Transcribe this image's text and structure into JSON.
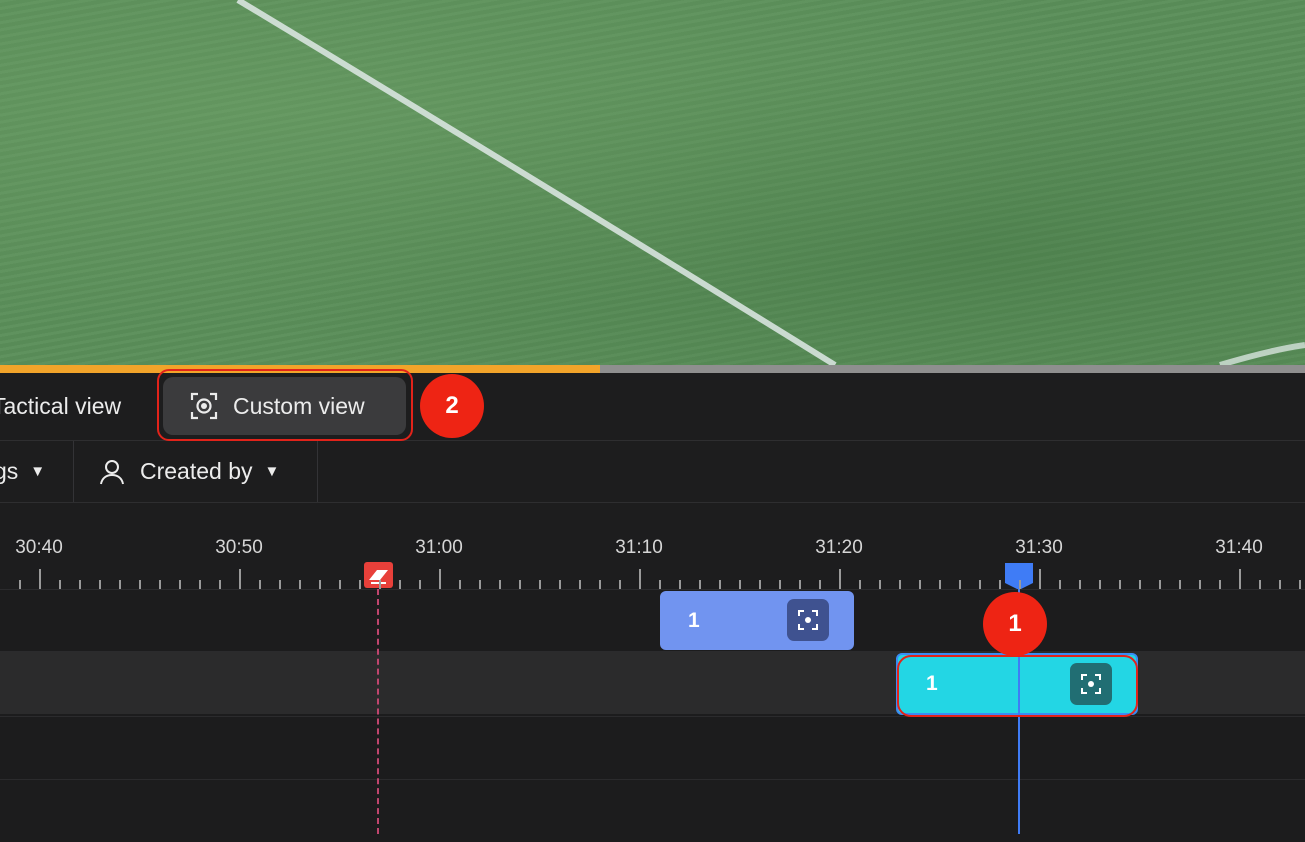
{
  "video": {
    "progress_percent": 46
  },
  "view_tabs": {
    "tactical_label": "Tactical view",
    "custom_label": "Custom view"
  },
  "filters": {
    "tags_label": "gs",
    "created_by_label": "Created by"
  },
  "timeline": {
    "tick_labels": [
      "30:40",
      "30:50",
      "31:00",
      "31:10",
      "31:20",
      "31:30",
      "31:40"
    ],
    "clips": [
      {
        "label": "1",
        "color": "#7194f0"
      },
      {
        "label": "1",
        "color": "#23d6e4",
        "selected": true
      }
    ],
    "marker_color": "#e8403a",
    "playhead_color": "#3f7cf6"
  },
  "annotations": [
    {
      "label": "1",
      "target": "selected-clip"
    },
    {
      "label": "2",
      "target": "custom-view-tab"
    }
  ]
}
